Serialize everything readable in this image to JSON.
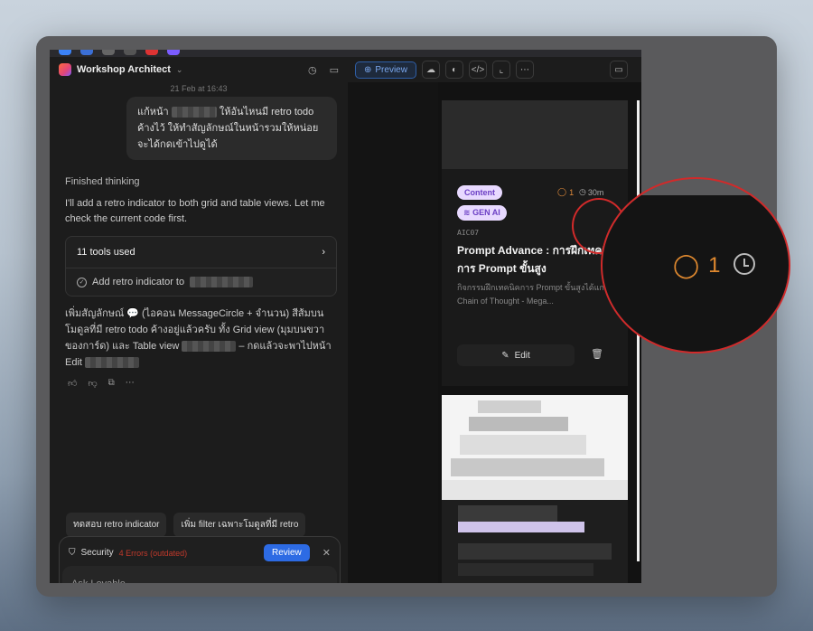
{
  "app": {
    "project_name": "Workshop Architect",
    "timestamp": "21 Feb at 16:43"
  },
  "chat": {
    "user_message_part1": "แก้หน้า",
    "user_message_part2": "ให้อันไหนมี retro todo ค้างไว้ ให้ทำสัญลักษณ์ในหน้ารวมให้หน่อยจะได้กดเข้าไปดูได้",
    "thinking": "Finished thinking",
    "reply": "I'll add a retro indicator to both grid and table views. Let me check the current code first.",
    "tools_used": "11 tools used",
    "tool_step": "Add retro indicator to",
    "reply2_a": "เพิ่มสัญลักษณ์ 💬 (ไอคอน MessageCircle + จำนวน) สีส้มบนโมดูลที่มี retro todo ค้างอยู่แล้วครับ ทั้ง Grid view (มุมบนขวาของการ์ด) และ Table view",
    "reply2_b": "– กดแล้วจะพาไปหน้า Edit",
    "suggestions": [
      "ทดสอบ retro indicator",
      "เพิ่ม filter เฉพาะโมดูลที่มี retro"
    ],
    "security_label": "Security",
    "security_errors": "4 Errors (outdated)",
    "review_label": "Review",
    "input_placeholder": "Ask Lovable..."
  },
  "toolbar": {
    "preview_label": "Preview"
  },
  "card": {
    "badge_content": "Content",
    "badge_gen": "GEN AI",
    "retro_count": "1",
    "duration": "30m",
    "code": "AIC07",
    "title": "Prompt Advance : การฝึกเทคนิคการ Prompt ขั้นสูง",
    "description": "กิจกรรมฝึกเทคนิคการ Prompt ขั้นสูงได้แก่ - Chain of Thought - Mega...",
    "edit_label": "Edit"
  },
  "zoom": {
    "retro_count": "1"
  },
  "colors": {
    "accent_blue": "#2d6be4",
    "retro_orange": "#e08a3a",
    "badge_bg": "#e8d9ff",
    "badge_text": "#6b3fc4",
    "annotation_red": "#d12a2a"
  }
}
